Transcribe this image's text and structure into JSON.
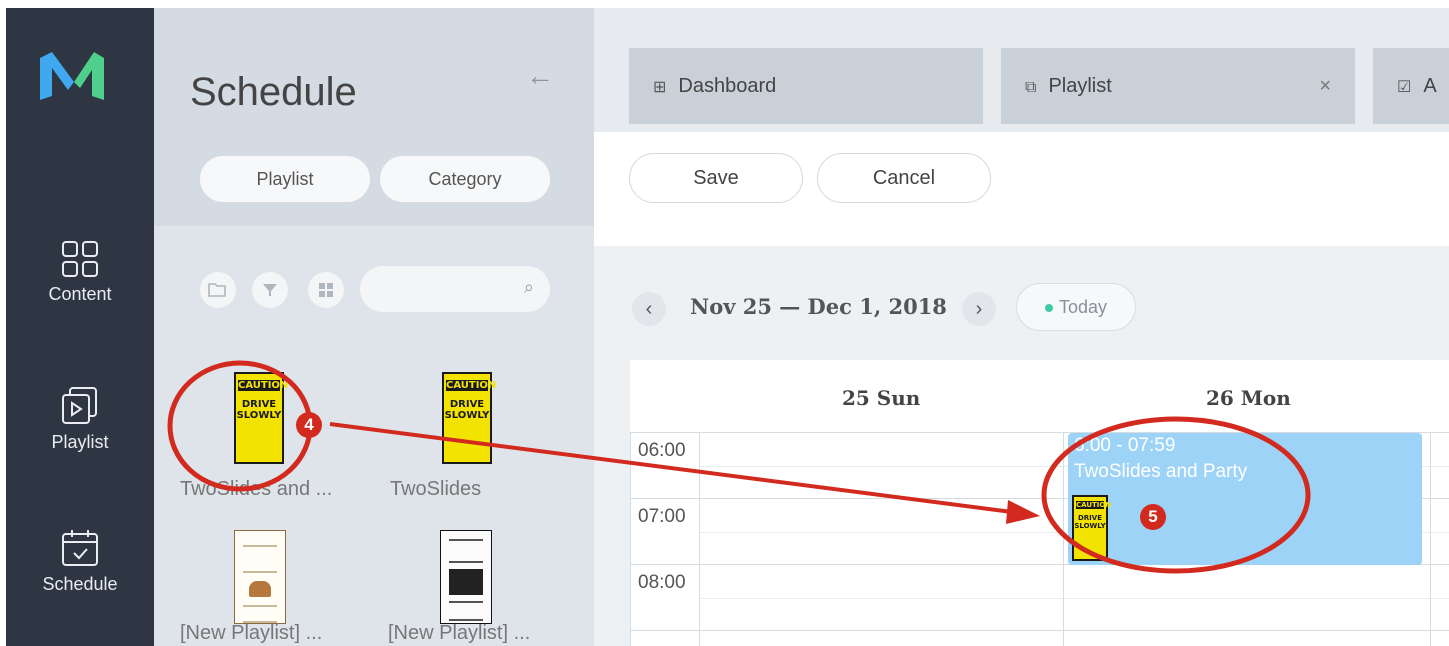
{
  "rail": {
    "items": [
      {
        "label": "Content",
        "icon": "grid-icon"
      },
      {
        "label": "Playlist",
        "icon": "playlist-icon"
      },
      {
        "label": "Schedule",
        "icon": "calendar-icon"
      }
    ]
  },
  "panel": {
    "title": "Schedule",
    "tabs": {
      "playlist": "Playlist",
      "category": "Category"
    },
    "items": [
      {
        "caption": "TwoSlides and ..."
      },
      {
        "caption": "TwoSlides"
      },
      {
        "caption": "[New Playlist] ..."
      },
      {
        "caption": "[New Playlist] ..."
      }
    ],
    "sign": {
      "top": "CAUTION",
      "line1": "DRIVE",
      "line2": "SLOWLY"
    }
  },
  "tabs": {
    "dashboard": "Dashboard",
    "playlist": "Playlist",
    "third": "A"
  },
  "toolbar": {
    "save": "Save",
    "cancel": "Cancel"
  },
  "calendar": {
    "range": "Nov 25 — Dec 1, 2018",
    "today": "Today",
    "days": [
      "25 Sun",
      "26 Mon"
    ],
    "times": [
      "06:00",
      "07:00",
      "08:00"
    ],
    "event": {
      "time": "6:00 - 07:59",
      "title": "TwoSlides and Party"
    }
  },
  "annotations": {
    "marker4": "4",
    "marker5": "5",
    "color": "#d22a1e"
  },
  "colors": {
    "rail": "#2d3642",
    "event": "#9dd3f7",
    "panel": "#dfe4ea"
  }
}
